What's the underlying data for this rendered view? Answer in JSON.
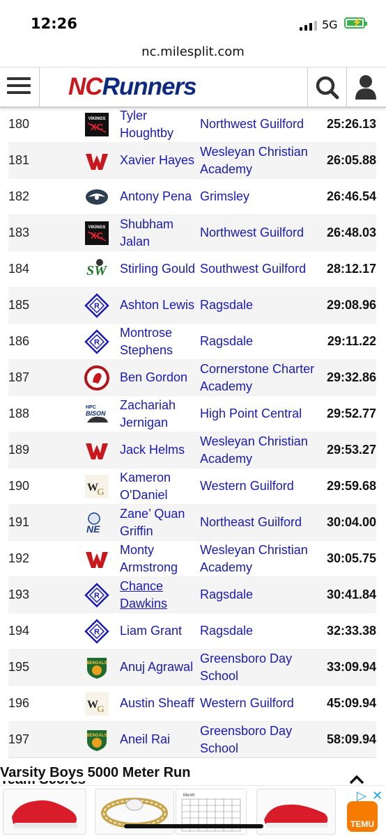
{
  "status": {
    "time": "12:26",
    "network": "5G"
  },
  "browser": {
    "url": "nc.milesplit.com"
  },
  "site": {
    "logo_nc": "NC",
    "logo_runners": "Runners"
  },
  "rows": [
    {
      "place": "180",
      "name": "Tyler Houghtby",
      "school": "Northwest Guilford",
      "time": "25:26.13",
      "logo": "vikings"
    },
    {
      "place": "181",
      "name": "Xavier Hayes",
      "school": "Wesleyan Christian Academy",
      "time": "26:05.88",
      "logo": "wesleyan"
    },
    {
      "place": "182",
      "name": "Antony Pena",
      "school": "Grimsley",
      "time": "26:46.54",
      "logo": "grimsley"
    },
    {
      "place": "183",
      "name": "Shubham Jalan",
      "school": "Northwest Guilford",
      "time": "26:48.03",
      "logo": "vikings"
    },
    {
      "place": "184",
      "name": "Stirling Gould",
      "school": "Southwest Guilford",
      "time": "28:12.17",
      "logo": "southwest"
    },
    {
      "place": "185",
      "name": "Ashton Lewis",
      "school": "Ragsdale",
      "time": "29:08.96",
      "logo": "ragsdale"
    },
    {
      "place": "186",
      "name": "Montrose Stephens",
      "school": "Ragsdale",
      "time": "29:11.22",
      "logo": "ragsdale"
    },
    {
      "place": "187",
      "name": "Ben Gordon",
      "school": "Cornerstone Charter Academy",
      "time": "29:32.86",
      "logo": "cornerstone"
    },
    {
      "place": "188",
      "name": "Zachariah Jernigan",
      "school": "High Point Central",
      "time": "29:52.77",
      "logo": "bison"
    },
    {
      "place": "189",
      "name": "Jack Helms",
      "school": "Wesleyan Christian Academy",
      "time": "29:53.27",
      "logo": "wesleyan"
    },
    {
      "place": "190",
      "name": "Kameron O'Daniel",
      "school": "Western Guilford",
      "time": "29:59.68",
      "logo": "western"
    },
    {
      "place": "191",
      "name": "Zane’ Quan Griffin",
      "school": "Northeast Guilford",
      "time": "30:04.00",
      "logo": "northeast"
    },
    {
      "place": "192",
      "name": "Monty Armstrong",
      "school": "Wesleyan Christian Academy",
      "time": "30:05.75",
      "logo": "wesleyan"
    },
    {
      "place": "193",
      "name": "Chance Dawkins",
      "school": "Ragsdale",
      "time": "30:41.84",
      "logo": "ragsdale",
      "underlined": true
    },
    {
      "place": "194",
      "name": "Liam Grant",
      "school": "Ragsdale",
      "time": "32:33.38",
      "logo": "ragsdale"
    },
    {
      "place": "195",
      "name": "Anuj Agrawal",
      "school": "Greensboro Day School",
      "time": "33:09.94",
      "logo": "bengals"
    },
    {
      "place": "196",
      "name": "Austin Sheaff",
      "school": "Western Guilford",
      "time": "45:09.94",
      "logo": "western"
    },
    {
      "place": "197",
      "name": "Aneil Rai",
      "school": "Greensboro Day School",
      "time": "58:09.94",
      "logo": "bengals"
    }
  ],
  "next_section": {
    "title": "Varsity Boys 5000 Meter Run",
    "subtitle": "Team Scores"
  },
  "ads": {
    "items": [
      "red-shoe-ad",
      "ring-ad",
      "calendar-ad",
      "red-sneaker-ad"
    ],
    "brand": "TEMU",
    "calendar_title": "Month"
  },
  "colors": {
    "link": "#1a1ab5",
    "brand_red": "#c8181e",
    "brand_blue": "#0d2a80",
    "alt_row": "#f4f4f4"
  }
}
